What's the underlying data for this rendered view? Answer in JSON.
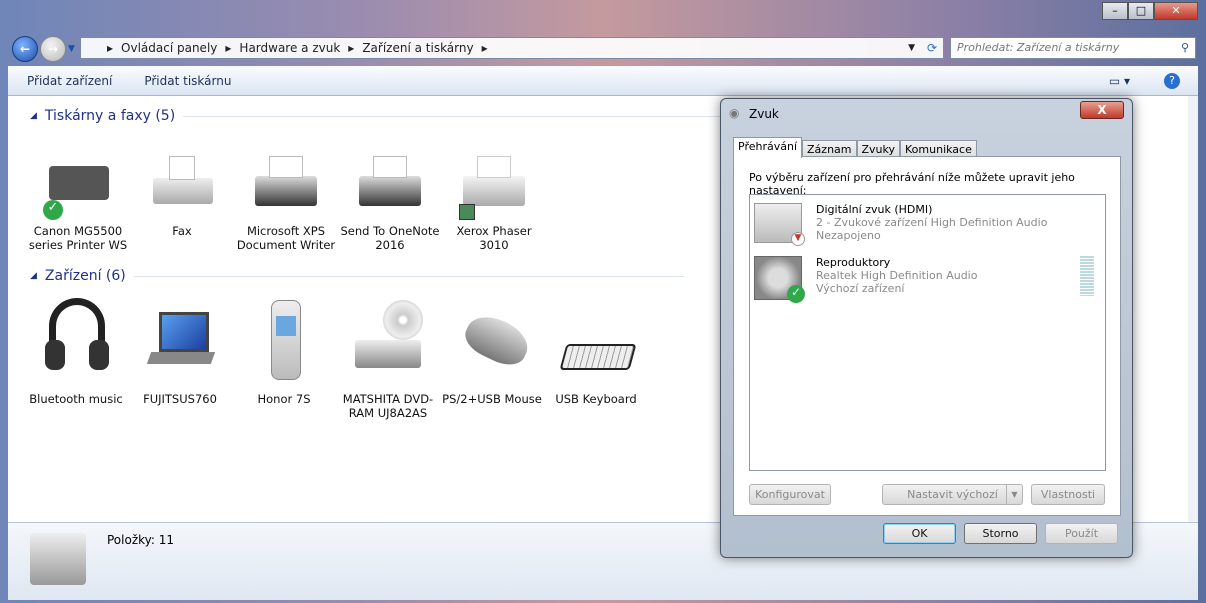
{
  "window": {
    "controls": [
      "minimize",
      "maximize",
      "close"
    ]
  },
  "nav": {
    "back": "back-icon",
    "forward": "forward-icon"
  },
  "breadcrumb": [
    "Ovládací panely",
    "Hardware a zvuk",
    "Zařízení a tiskárny"
  ],
  "search": {
    "placeholder": "Prohledat: Zařízení a tiskárny"
  },
  "toolbar": {
    "add_device": "Přidat zařízení",
    "add_printer": "Přidat tiskárnu"
  },
  "groups": {
    "printers": "Tiskárny a faxy (5)",
    "devices": "Zařízení (6)"
  },
  "printers": [
    "Canon MG5500 series Printer WS",
    "Fax",
    "Microsoft XPS Document Writer",
    "Send To OneNote 2016",
    "Xerox Phaser 3010"
  ],
  "devices": [
    "Bluetooth music",
    "FUJITSUS760",
    "Honor 7S",
    "MATSHITA DVD-RAM UJ8A2AS",
    "PS/2+USB Mouse",
    "USB Keyboard"
  ],
  "status": {
    "count": "Položky: 11"
  },
  "dialog": {
    "title": "Zvuk",
    "close": "X",
    "tabs": [
      "Přehrávání",
      "Záznam",
      "Zvuky",
      "Komunikace"
    ],
    "instruction": "Po výběru zařízení pro přehrávání níže můžete upravit jeho nastavení:",
    "devices": [
      {
        "name": "Digitální zvuk (HDMI)",
        "driver": "2 - Zvukové zařízení High Definition Audio",
        "state": "Nezapojeno"
      },
      {
        "name": "Reproduktory",
        "driver": "Realtek High Definition Audio",
        "state": "Výchozí zařízení"
      }
    ],
    "buttons": {
      "configure": "Konfigurovat",
      "set_default": "Nastavit výchozí",
      "properties": "Vlastnosti",
      "ok": "OK",
      "cancel": "Storno",
      "apply": "Použít"
    }
  },
  "colors": {
    "link": "#1e3287",
    "accent": "#2a6fd0"
  }
}
